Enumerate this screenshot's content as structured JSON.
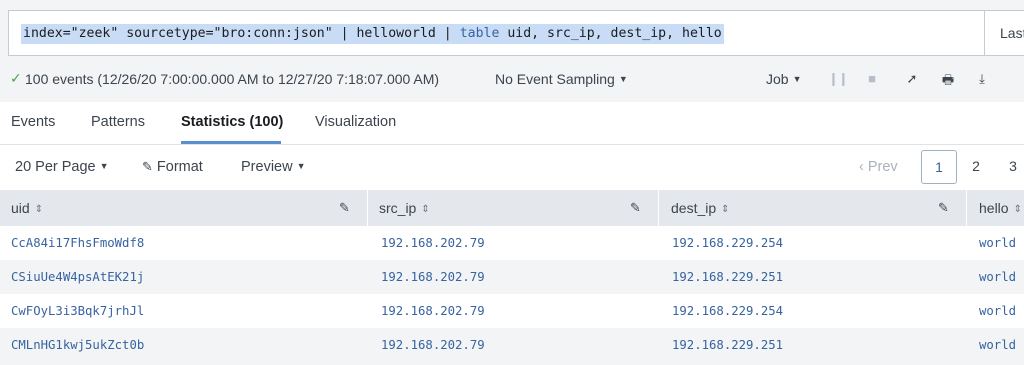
{
  "search": {
    "query_part1": "index=\"zeek\" sourcetype=\"bro:conn:json\" | helloworld | ",
    "query_keyword": "table",
    "query_part2": " uid, src_ip, dest_ip, hello",
    "time_picker_label": "Last"
  },
  "status": {
    "check_icon": "check-icon",
    "text": "100 events (12/26/20 7:00:00.000 AM to 12/27/20 7:18:07.000 AM)",
    "sampling_label": "No Event Sampling",
    "job_label": "Job",
    "check_color": "#53a051"
  },
  "toolbar": {
    "pause_glyph": "❙❙",
    "stop_glyph": "■",
    "share_glyph": "➚",
    "print_glyph": "🖶",
    "export_glyph": "⤓"
  },
  "tabs": [
    {
      "label": "Events"
    },
    {
      "label": "Patterns"
    },
    {
      "label": "Statistics (100)",
      "active": true
    },
    {
      "label": "Visualization"
    }
  ],
  "pager": {
    "per_page_label": "20 Per Page",
    "format_label": "Format",
    "preview_label": "Preview",
    "prev_label": "‹ Prev",
    "pages": [
      "1",
      "2",
      "3"
    ],
    "current_page": "1"
  },
  "table": {
    "columns": [
      "uid",
      "src_ip",
      "dest_ip",
      "hello"
    ],
    "rows": [
      [
        "CcA84i17FhsFmoWdf8",
        "192.168.202.79",
        "192.168.229.254",
        "world"
      ],
      [
        "CSiuUe4W4psAtEK21j",
        "192.168.202.79",
        "192.168.229.251",
        "world"
      ],
      [
        "CwFOyL3i3Bqk7jrhJl",
        "192.168.202.79",
        "192.168.229.254",
        "world"
      ],
      [
        "CMLnHG1kwj5ukZct0b",
        "192.168.202.79",
        "192.168.229.251",
        "world"
      ]
    ]
  },
  "colors": {
    "accent": "#5a8fce",
    "link": "#3863a0",
    "selection": "#c9dcf6"
  }
}
